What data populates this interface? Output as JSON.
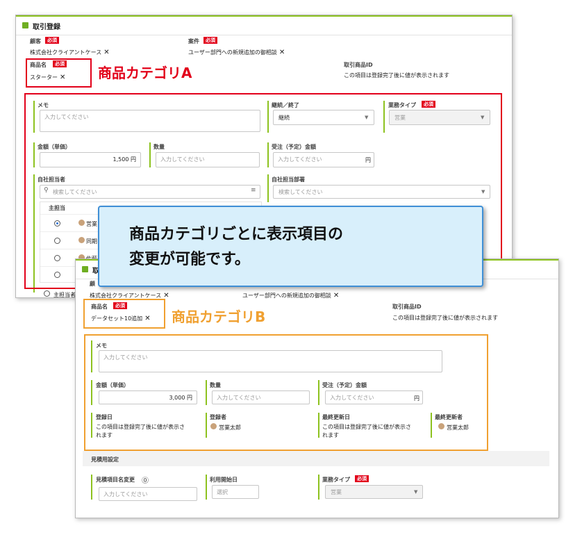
{
  "panel_a": {
    "title": "取引登録",
    "customer_label": "顧客",
    "required": "必須",
    "customer_value": "株式会社クライアントケース",
    "deal_label": "案件",
    "deal_value": "ユーザー部門への新規追加の御相談",
    "product_label": "商品名",
    "product_value": "スターター",
    "product_id_label": "取引商品ID",
    "product_id_note": "この項目は登録完了後に値が表示されます",
    "memo_label": "メモ",
    "memo_placeholder": "入力してください",
    "continue_label": "継続／終了",
    "continue_value": "継続",
    "business_type_label": "業務タイプ",
    "business_type_value": "営業",
    "unit_price_label": "金額（単価）",
    "unit_price_value": "1,500 円",
    "quantity_label": "数量",
    "quantity_placeholder": "入力してください",
    "order_amount_label": "受注（予定）金額",
    "order_amount_placeholder": "入力してください",
    "order_amount_unit": "円",
    "staff_label": "自社担当者",
    "staff_search_placeholder": "検索してください",
    "staff_col_main": "主担当",
    "staff_rows": [
      "営業",
      "同期",
      "佐藤"
    ],
    "dept_label": "自社担当部署",
    "dept_placeholder": "検索してください",
    "main_staff_footer": "主担当者"
  },
  "category_a": "商品カテゴリA",
  "callout_lines": [
    "商品カテゴリごとに表示項目の",
    "変更が可能です。"
  ],
  "panel_b": {
    "title": "取",
    "customer_label": "顧",
    "customer_value": "株式会社クライアントケース",
    "deal_value": "ユーザー部門への新規追加の御相談",
    "product_label": "商品名",
    "required": "必須",
    "product_value": "データセット10追加",
    "product_id_label": "取引商品ID",
    "product_id_note": "この項目は登録完了後に値が表示されます",
    "memo_label": "メモ",
    "memo_placeholder": "入力してください",
    "unit_price_label": "金額（単価）",
    "unit_price_value": "3,000 円",
    "quantity_label": "数量",
    "quantity_placeholder": "入力してください",
    "order_amount_label": "受注（予定）金額",
    "order_amount_placeholder": "入力してください",
    "order_amount_unit": "円",
    "registered_date_label": "登録日",
    "registered_date_note": [
      "この項目は登録完了後に値が表示さ",
      "れます"
    ],
    "registrant_label": "登録者",
    "registrant_value": "営業太郎",
    "updated_date_label": "最終更新日",
    "updated_date_note": [
      "この項目は登録完了後に値が表示さ",
      "れます"
    ],
    "updater_label": "最終更新者",
    "updater_value": "営業太郎",
    "estimate_section": "見積用設定",
    "estimate_item_label": "見積項目名変更",
    "estimate_item_placeholder": "入力してください",
    "start_date_label": "利用開始日",
    "start_date_placeholder": "選択",
    "business_type_label": "業務タイプ",
    "business_type_value": "営業"
  },
  "category_b": "商品カテゴリB",
  "colors": {
    "accent_green": "#8dc21f",
    "required_red": "#e2001a",
    "category_a": "#e2001a",
    "category_b": "#f0a030",
    "callout_border": "#3f8fd6"
  }
}
